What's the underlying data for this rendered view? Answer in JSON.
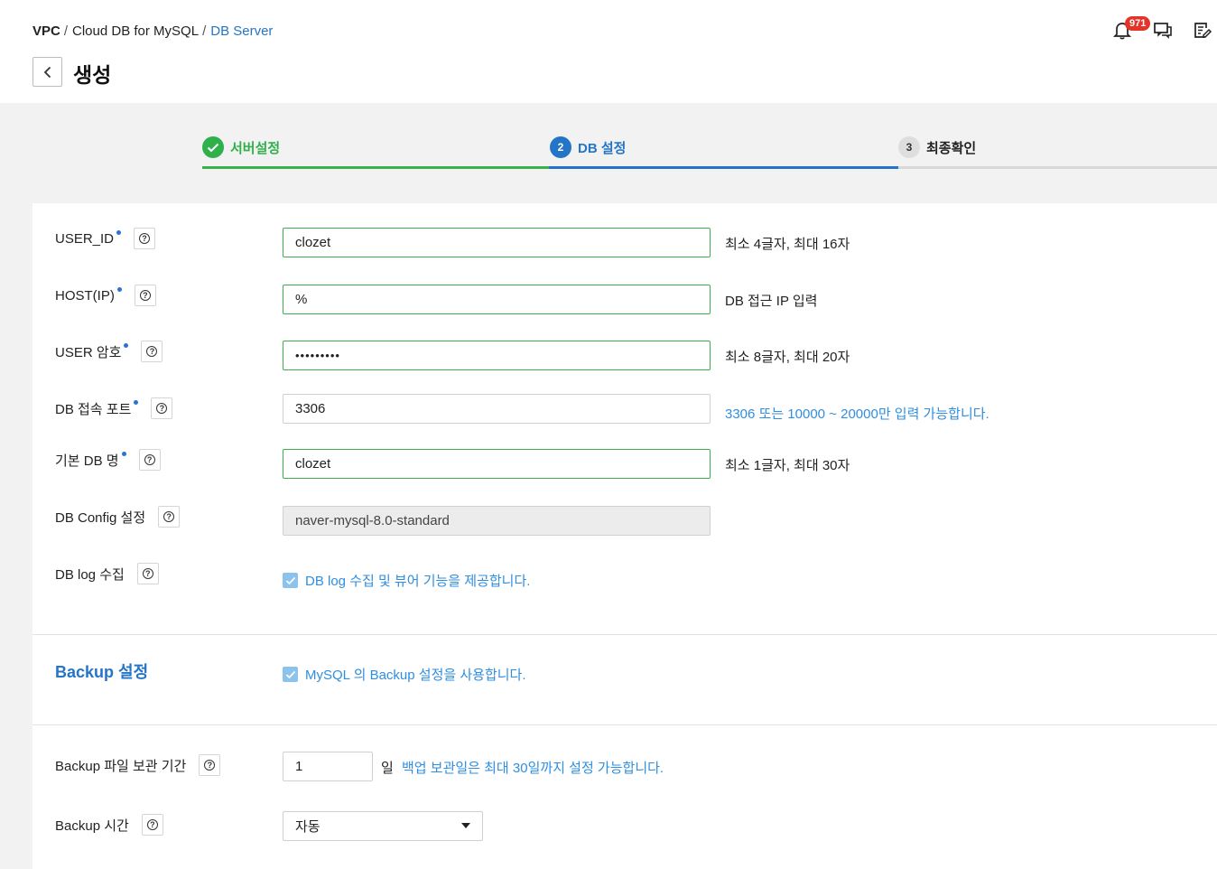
{
  "breadcrumb": {
    "items": [
      "VPC",
      "Cloud DB for MySQL",
      "DB Server"
    ],
    "separator": "/"
  },
  "page": {
    "title": "생성"
  },
  "notifications": {
    "count": "971"
  },
  "steps": [
    {
      "label": "서버설정",
      "status": "done",
      "number": ""
    },
    {
      "label": "DB 설정",
      "status": "active",
      "number": "2"
    },
    {
      "label": "최종확인",
      "status": "pending",
      "number": "3"
    }
  ],
  "form": {
    "user_id": {
      "label": "USER_ID",
      "value": "clozet",
      "hint": "최소 4글자, 최대 16자"
    },
    "host_ip": {
      "label": "HOST(IP)",
      "value": "%",
      "hint": "DB 접근 IP 입력"
    },
    "user_password": {
      "label": "USER 암호",
      "value": "•••••••••",
      "hint": "최소 8글자, 최대 20자"
    },
    "db_port": {
      "label": "DB 접속 포트",
      "value": "3306",
      "hint": "3306 또는 10000 ~ 20000만 입력 가능합니다."
    },
    "default_db": {
      "label": "기본 DB 명",
      "value": "clozet",
      "hint": "최소 1글자, 최대 30자"
    },
    "db_config": {
      "label": "DB Config 설정",
      "value": "naver-mysql-8.0-standard"
    },
    "db_log": {
      "label": "DB log 수집",
      "checkbox_label": "DB log 수집 및 뷰어 기능을 제공합니다.",
      "checked": true
    }
  },
  "backup": {
    "section_title": "Backup 설정",
    "enable_label": "MySQL 의 Backup 설정을 사용합니다.",
    "enabled": true,
    "retention": {
      "label": "Backup 파일 보관 기간",
      "value": "1",
      "unit": "일",
      "hint": "백업 보관일은 최대 30일까지 설정 가능합니다."
    },
    "time": {
      "label": "Backup 시간",
      "value": "자동"
    }
  },
  "colors": {
    "accent_blue": "#2475c7",
    "success_green": "#3cb04a",
    "hint_blue": "#2f8ee0"
  },
  "icons": [
    "bell-icon",
    "chat-icon",
    "memo-icon",
    "chevron-left-icon",
    "help-icon",
    "check-icon",
    "caret-down-icon"
  ]
}
